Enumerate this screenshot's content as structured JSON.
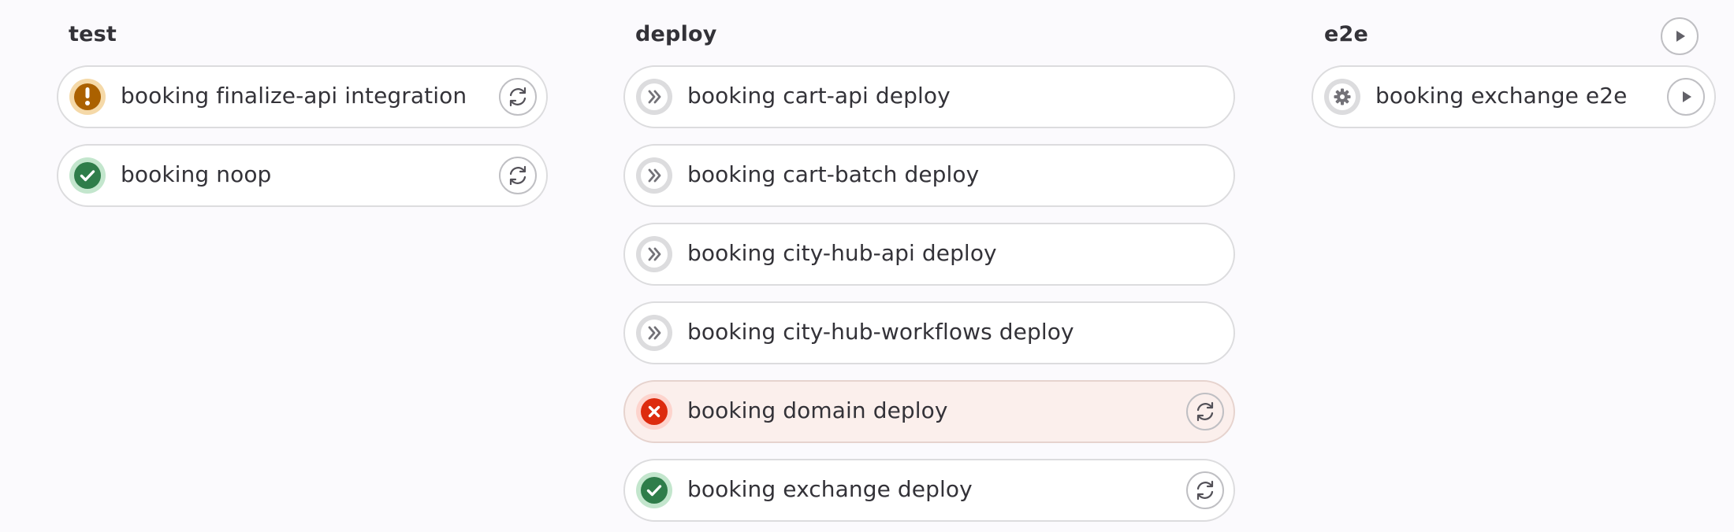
{
  "stages": {
    "test": {
      "title": "test",
      "jobs": [
        {
          "name": "booking finalize-api integration",
          "status": "warning",
          "action": "retry-icon"
        },
        {
          "name": "booking noop",
          "status": "success",
          "action": "retry-icon"
        }
      ]
    },
    "deploy": {
      "title": "deploy",
      "jobs": [
        {
          "name": "booking cart-api deploy",
          "status": "skipped",
          "action": ""
        },
        {
          "name": "booking cart-batch deploy",
          "status": "skipped",
          "action": ""
        },
        {
          "name": "booking city-hub-api deploy",
          "status": "skipped",
          "action": ""
        },
        {
          "name": "booking city-hub-workflows deploy",
          "status": "skipped",
          "action": ""
        },
        {
          "name": "booking domain deploy",
          "status": "failed",
          "action": "retry-icon"
        },
        {
          "name": "booking exchange deploy",
          "status": "success",
          "action": "retry-icon"
        }
      ]
    },
    "e2e": {
      "title": "e2e",
      "stage_action": "play-icon",
      "jobs": [
        {
          "name": "booking exchange e2e",
          "status": "manual",
          "action": "play-icon"
        }
      ]
    }
  },
  "colors": {
    "warning": "#ab6100",
    "warning_bg": "#f5d9a8",
    "success": "#2f7d4a",
    "success_bg": "#c3e6cd",
    "failed": "#dd2b0e",
    "failed_bg": "#fdd4cd",
    "neutral": "#737278",
    "neutral_bg": "#dcdcde"
  }
}
